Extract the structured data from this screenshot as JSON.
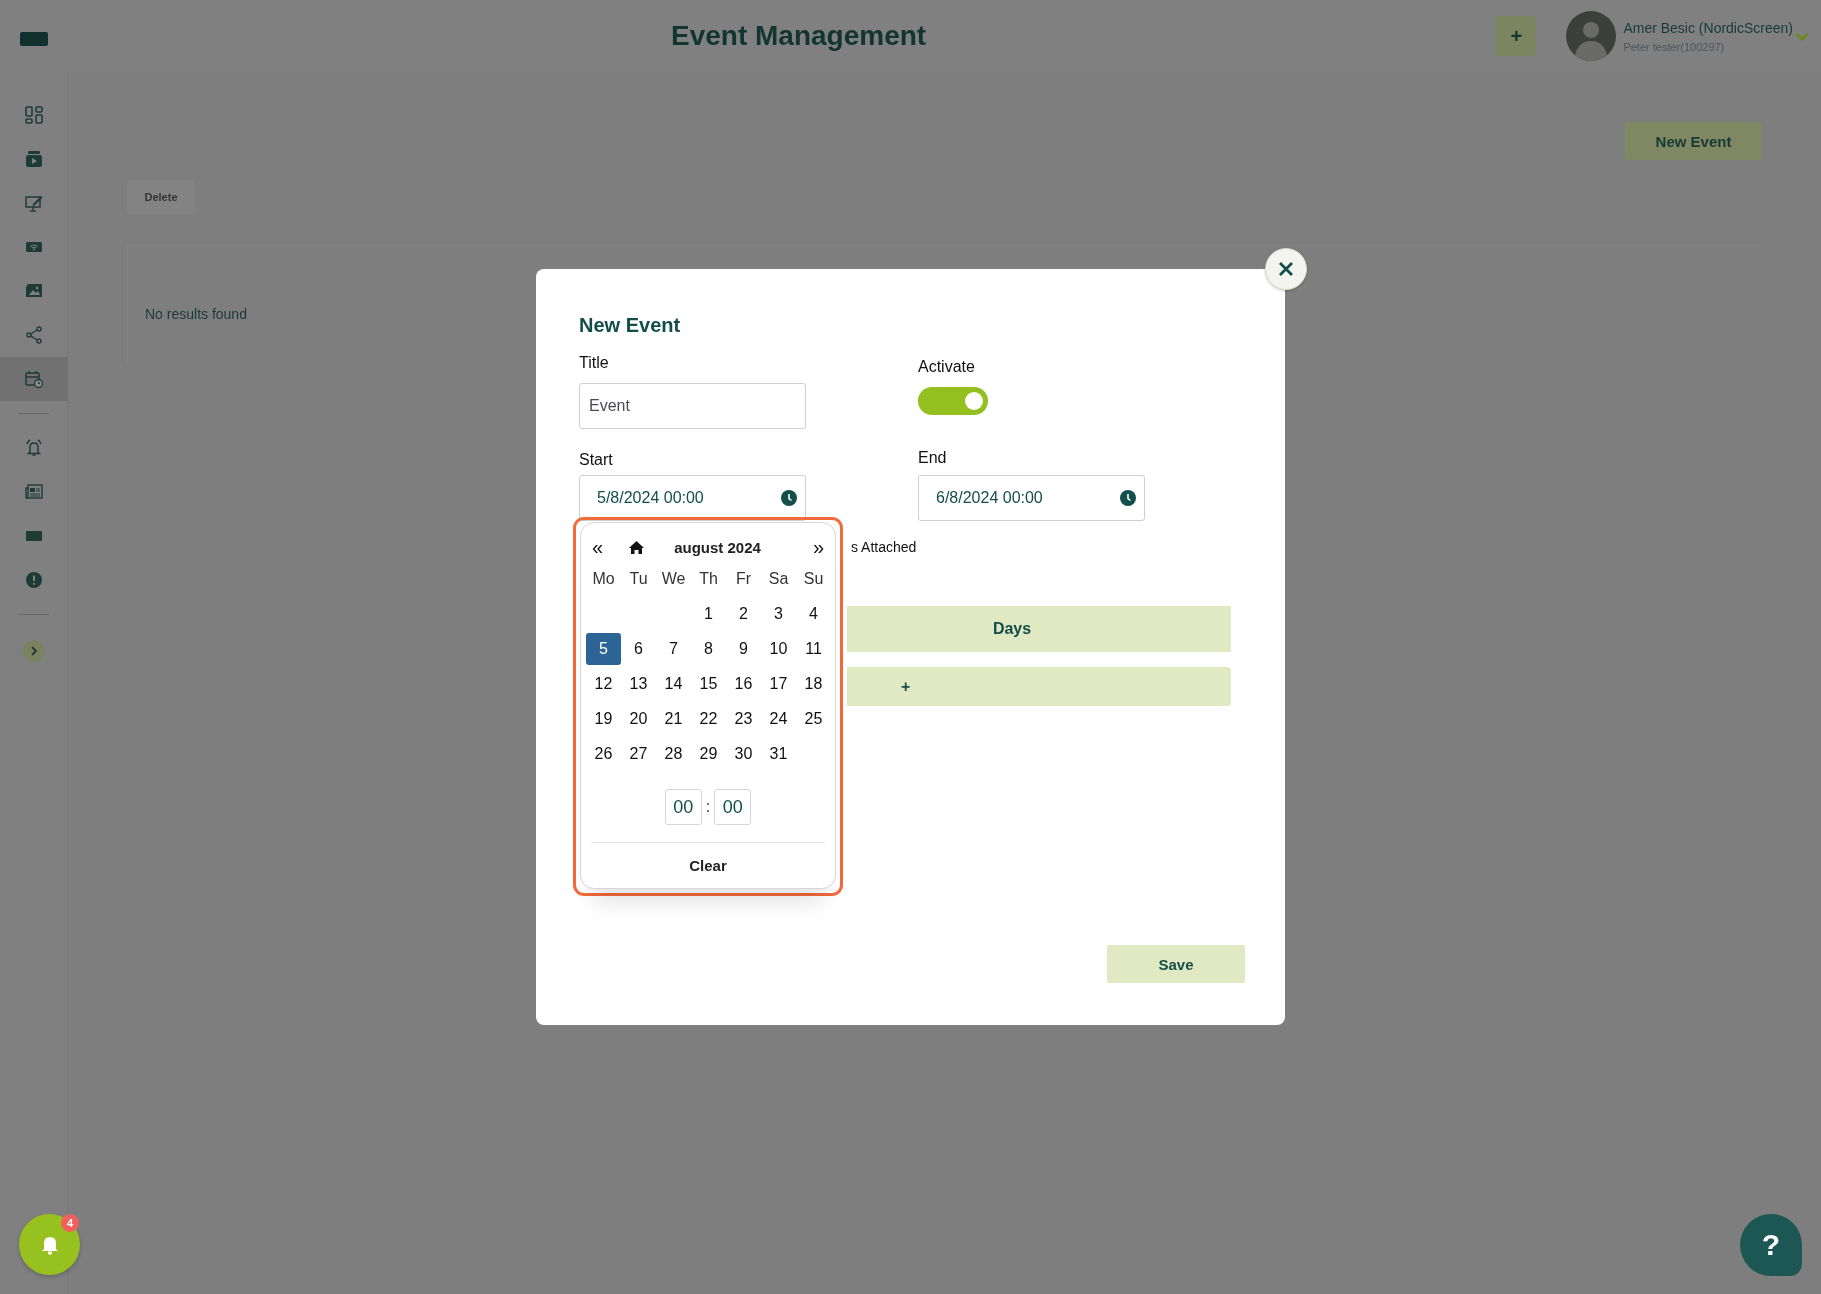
{
  "header": {
    "title": "Event Management",
    "add_button": "+",
    "user_name": "Amer Besic (NordicScreen)",
    "user_account": "Peter tester(100297)"
  },
  "sidebar": {
    "groups": [
      {
        "items": [
          {
            "selected": false
          },
          {
            "selected": false
          },
          {
            "selected": false
          },
          {
            "selected": false
          },
          {
            "selected": false
          },
          {
            "selected": false
          },
          {
            "selected": true
          }
        ]
      },
      {
        "items": [
          {
            "selected": false
          },
          {
            "selected": false
          },
          {
            "selected": false
          },
          {
            "selected": false
          }
        ]
      }
    ]
  },
  "page": {
    "new_event_button": "New Event",
    "delete_button": "Delete",
    "empty_message": "No results found"
  },
  "modal": {
    "title": "New Event",
    "title_label": "Title",
    "title_value": "Event",
    "activate_label": "Activate",
    "activate_on": true,
    "start_label": "Start",
    "start_value": "5/8/2024 00:00",
    "end_label": "End",
    "end_value": "6/8/2024 00:00",
    "attached_label": "s Attached",
    "days_header": "Days",
    "add_button": "+",
    "save_button": "Save"
  },
  "date_picker": {
    "prev_button": "«",
    "next_button": "»",
    "month": "august 2024",
    "weekdays": [
      "Mo",
      "Tu",
      "We",
      "Th",
      "Fr",
      "Sa",
      "Su"
    ],
    "weeks": [
      [
        {
          "day": "1",
          "selected": false
        },
        {
          "day": "2",
          "selected": false
        },
        {
          "day": "3",
          "selected": false
        },
        {
          "day": "4",
          "selected": false
        }
      ],
      [
        {
          "day": "5",
          "selected": true
        },
        {
          "day": "6",
          "selected": false
        },
        {
          "day": "7",
          "selected": false
        },
        {
          "day": "8",
          "selected": false
        },
        {
          "day": "9",
          "selected": false
        },
        {
          "day": "10",
          "selected": false
        },
        {
          "day": "11",
          "selected": false
        }
      ],
      [
        {
          "day": "12",
          "selected": false
        },
        {
          "day": "13",
          "selected": false
        },
        {
          "day": "14",
          "selected": false
        },
        {
          "day": "15",
          "selected": false
        },
        {
          "day": "16",
          "selected": false
        },
        {
          "day": "17",
          "selected": false
        },
        {
          "day": "18",
          "selected": false
        }
      ],
      [
        {
          "day": "19",
          "selected": false
        },
        {
          "day": "20",
          "selected": false
        },
        {
          "day": "21",
          "selected": false
        },
        {
          "day": "22",
          "selected": false
        },
        {
          "day": "23",
          "selected": false
        },
        {
          "day": "24",
          "selected": false
        },
        {
          "day": "25",
          "selected": false
        }
      ],
      [
        {
          "day": "26",
          "selected": false
        },
        {
          "day": "27",
          "selected": false
        },
        {
          "day": "28",
          "selected": false
        },
        {
          "day": "29",
          "selected": false
        },
        {
          "day": "30",
          "selected": false
        },
        {
          "day": "31",
          "selected": false
        }
      ]
    ],
    "hour": "00",
    "time_separator": ":",
    "minute": "00",
    "clear_button": "Clear"
  },
  "notifications": {
    "count": "4"
  },
  "help_button": "?"
}
